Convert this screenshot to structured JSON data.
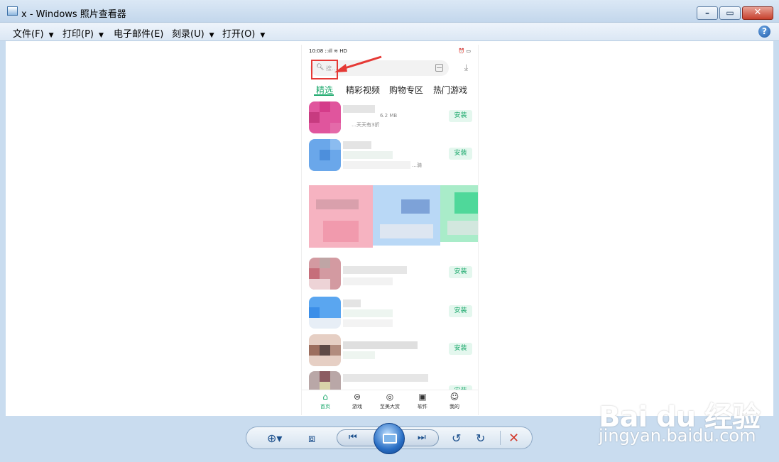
{
  "window": {
    "title": "x - Windows 照片查看器",
    "menu": [
      "文件(F)",
      "打印(P)",
      "电子邮件(E)",
      "刻录(U)",
      "打开(O)"
    ]
  },
  "phone": {
    "status_left": "10:08 ::ıll ≋ HD",
    "status_right": "⏰ ▭",
    "search_placeholder": "搜…",
    "tabs": [
      "精选",
      "精彩视频",
      "购物专区",
      "热门游戏"
    ],
    "apps": [
      {
        "sub1": "6.2 MB",
        "sub2": "…天天有3折",
        "install": "安装"
      },
      {
        "sub1": "",
        "sub2": "…骑",
        "install": "安装"
      },
      {
        "sub1": "",
        "sub2": "",
        "install": "安装"
      },
      {
        "sub1": "",
        "sub2": "",
        "install": "安装"
      },
      {
        "sub1": "",
        "sub2": "",
        "install": "安装"
      },
      {
        "sub1": "",
        "sub2": "",
        "install": "安装"
      }
    ],
    "bottom_nav": [
      "首页",
      "游戏",
      "至美大赏",
      "软件",
      "我的"
    ]
  },
  "watermark": {
    "logo": "Bai  du 经验",
    "url": "jingyan.baidu.com"
  },
  "colors": {
    "accent_green": "#1aa86b",
    "highlight_red": "#e53935"
  }
}
